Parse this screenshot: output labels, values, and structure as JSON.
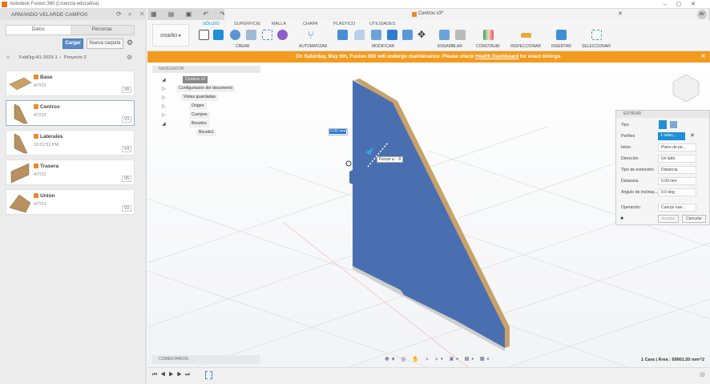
{
  "window": {
    "title": "Autodesk Fusion 360 (Licencia educativa)"
  },
  "left_panel": {
    "user": "ARMANDO VELARDE CAMPOS",
    "tabs": [
      "Datos",
      "Personas"
    ],
    "upload": "Cargar",
    "new_folder": "Nueva carpeta",
    "breadcrumb": [
      "FabDig-A1-2023-1",
      "Proyecto 2"
    ],
    "files": [
      {
        "name": "Base",
        "date": "4/7/23",
        "version": "V8"
      },
      {
        "name": "Centros",
        "date": "4/7/23",
        "version": "V3"
      },
      {
        "name": "Laterales",
        "date": "10:01:51 PM",
        "version": "V4"
      },
      {
        "name": "Trasera",
        "date": "4/7/23",
        "version": "V5"
      },
      {
        "name": "Unión",
        "date": "4/7/23",
        "version": "V3"
      }
    ]
  },
  "document": {
    "tab": "Centros v3*",
    "user_initials": "AV"
  },
  "ribbon": {
    "workspace": "DISEÑO",
    "tabs": [
      "SÓLIDO",
      "SUPERFICIE",
      "MALLA",
      "CHAPA",
      "PLÁSTICO",
      "UTILIDADES"
    ],
    "groups": [
      "CREAR",
      "AUTOMATIZAR",
      "MODIFICAR",
      "ENSAMBLAR",
      "CONSTRUIR",
      "INSPECCIONAR",
      "INSERTAR",
      "SELECCIONAR"
    ]
  },
  "banner": {
    "text": "On Saturday, May 6th, Fusion 360 will undergo maintenance. Please check ",
    "link": "Health Dashboard",
    "tail": " for exact timings."
  },
  "navigator": {
    "title": "NAVEGADOR",
    "root": "Centros v3",
    "items": [
      "Configuración del documento",
      "Vistas guardadas",
      "Origen",
      "Cuerpos",
      "Bocetos",
      "Boceto1"
    ]
  },
  "comments": "COMENTARIOS",
  "viewport": {
    "distance_input": "0.00 mm",
    "tooltip": "Forzar a : -9",
    "status": "1 Cara | Área : 69901.50 mm^2"
  },
  "extrude": {
    "title": "EXTRUIR",
    "rows": [
      {
        "label": "Tipo",
        "value": ""
      },
      {
        "label": "Perfiles",
        "value": "1 selec..."
      },
      {
        "label": "Inicio",
        "value": "Plano de pe..."
      },
      {
        "label": "Dirección",
        "value": "Un lado"
      },
      {
        "label": "Tipo de extensión",
        "value": "Distancia"
      },
      {
        "label": "Distancia",
        "value": "0.00 mm"
      },
      {
        "label": "Ángulo de inclinac...",
        "value": "0.0 deg"
      },
      {
        "label": "Operación",
        "value": "Cuerpo nue..."
      }
    ],
    "ok": "Aceptar",
    "cancel": "Cancelar"
  },
  "colors": {
    "accent": "#0696d7",
    "banner": "#f39b1f",
    "body": "#4a6fb0",
    "wood": "#c9a26a"
  }
}
